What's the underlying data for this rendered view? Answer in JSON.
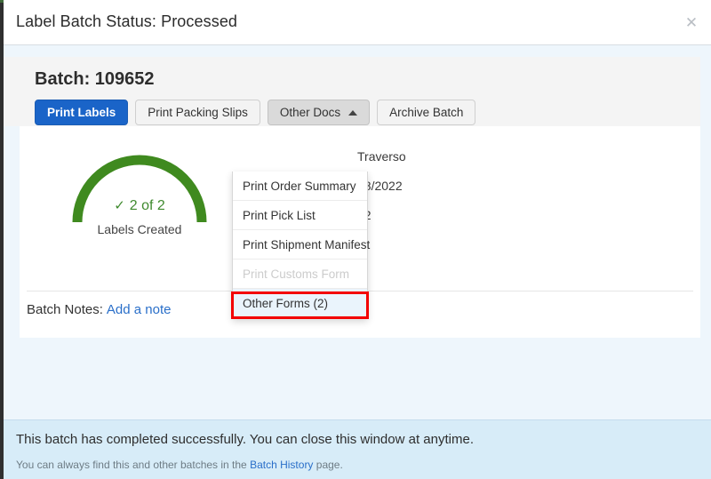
{
  "titlebar": {
    "title": "Label Batch Status: Processed",
    "close_icon": "close-icon",
    "close_glyph": "✕"
  },
  "panel": {
    "batch_title": "Batch: 109652",
    "buttons": [
      {
        "label": "Print Labels",
        "style": "primary"
      },
      {
        "label": "Print Packing Slips",
        "style": "default"
      },
      {
        "label": "Other Docs",
        "style": "active",
        "caret": "caret-up-icon"
      },
      {
        "label": "Archive Batch",
        "style": "default"
      }
    ]
  },
  "gauge": {
    "check_glyph": "✓",
    "count": "2 of 2",
    "label": "Labels Created",
    "arc_color": "#3f8a1f",
    "text_color": "#3f8a2e"
  },
  "details": [
    "Traverso",
    "18/2022",
    "22"
  ],
  "notes": {
    "label": "Batch Notes:",
    "link": "Add a note"
  },
  "dropdown": {
    "items": [
      {
        "label": "Print Order Summary",
        "state": "normal"
      },
      {
        "label": "Print Pick List",
        "state": "normal"
      },
      {
        "label": "Print Shipment Manifest",
        "state": "normal"
      },
      {
        "label": "Print Customs Form",
        "state": "disabled"
      },
      {
        "label": "Other Forms (2)",
        "state": "highlighted"
      }
    ],
    "highlight_color": "#f30000"
  },
  "footer": {
    "main": "This batch has completed successfully. You can close this window at anytime.",
    "sub_before": "You can always find this and other batches in the",
    "sub_link": "Batch History",
    "sub_after": "page."
  }
}
